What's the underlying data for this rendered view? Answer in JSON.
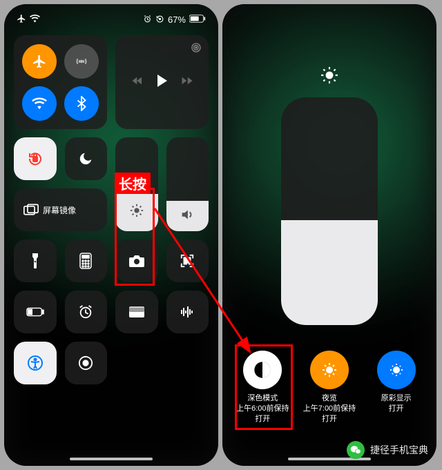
{
  "status": {
    "battery": "67%"
  },
  "screen_mirroring": "屏幕镜像",
  "annotation": {
    "label": "长按"
  },
  "detail": {
    "dark_mode": {
      "title": "深色模式",
      "subtitle": "上午6:00前保持\n打开"
    },
    "night_shift": {
      "title": "夜览",
      "subtitle": "上午7:00前保持\n打开"
    },
    "true_tone": {
      "title": "原彩显示",
      "subtitle": "打开"
    }
  },
  "watermark": "捷径手机宝典",
  "colors": {
    "orange": "#ff9500",
    "blue": "#007aff",
    "red": "#ff0000",
    "green": "#2fbe41",
    "white": "#ffffff"
  },
  "icons": {
    "airplane": "airplane",
    "celldata": "cellular-antenna",
    "wifi": "wifi",
    "bluetooth": "bluetooth",
    "rotation": "rotation-lock",
    "dnd": "moon",
    "brightness": "sun",
    "volume": "speaker",
    "flashlight": "flashlight",
    "calculator": "calculator",
    "camera": "camera",
    "qr": "qr-scanner",
    "battery": "low-power",
    "alarm": "alarm-clock",
    "wallet": "wallet",
    "sound": "sound-recognition",
    "accessibility": "accessibility",
    "record": "screen-record",
    "darkmode": "half-circle",
    "truetone": "true-tone"
  }
}
